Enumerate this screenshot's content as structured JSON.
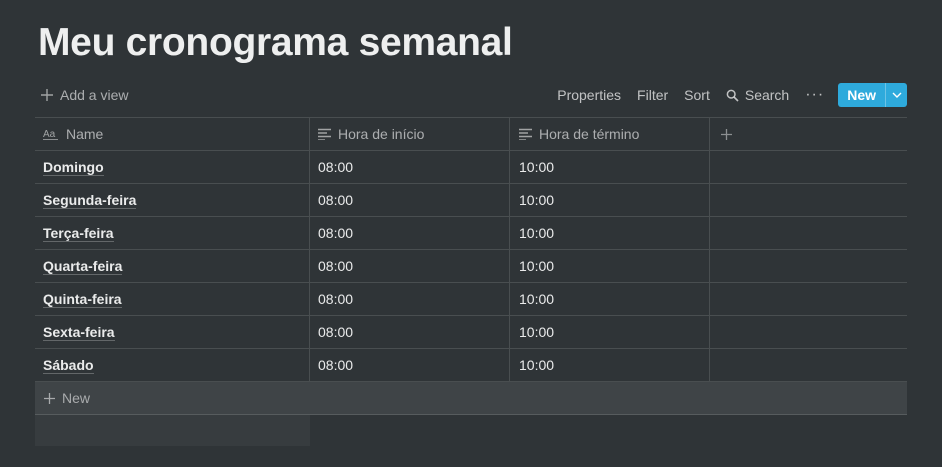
{
  "page": {
    "title": "Meu cronograma semanal"
  },
  "toolbar": {
    "add_view": "Add a view",
    "properties": "Properties",
    "filter": "Filter",
    "sort": "Sort",
    "search": "Search",
    "more": "···",
    "new": "New"
  },
  "table": {
    "headers": {
      "name": "Name",
      "start": "Hora de início",
      "end": "Hora de término"
    },
    "rows": [
      {
        "name": "Domingo",
        "start": "08:00",
        "end": "10:00"
      },
      {
        "name": "Segunda-feira",
        "start": "08:00",
        "end": "10:00"
      },
      {
        "name": "Terça-feira",
        "start": "08:00",
        "end": "10:00"
      },
      {
        "name": "Quarta-feira",
        "start": "08:00",
        "end": "10:00"
      },
      {
        "name": "Quinta-feira",
        "start": "08:00",
        "end": "10:00"
      },
      {
        "name": "Sexta-feira",
        "start": "08:00",
        "end": "10:00"
      },
      {
        "name": "Sábado",
        "start": "08:00",
        "end": "10:00"
      }
    ],
    "new_row_label": "New",
    "accent_color": "#2eaadc",
    "background_color": "#2f3437"
  }
}
